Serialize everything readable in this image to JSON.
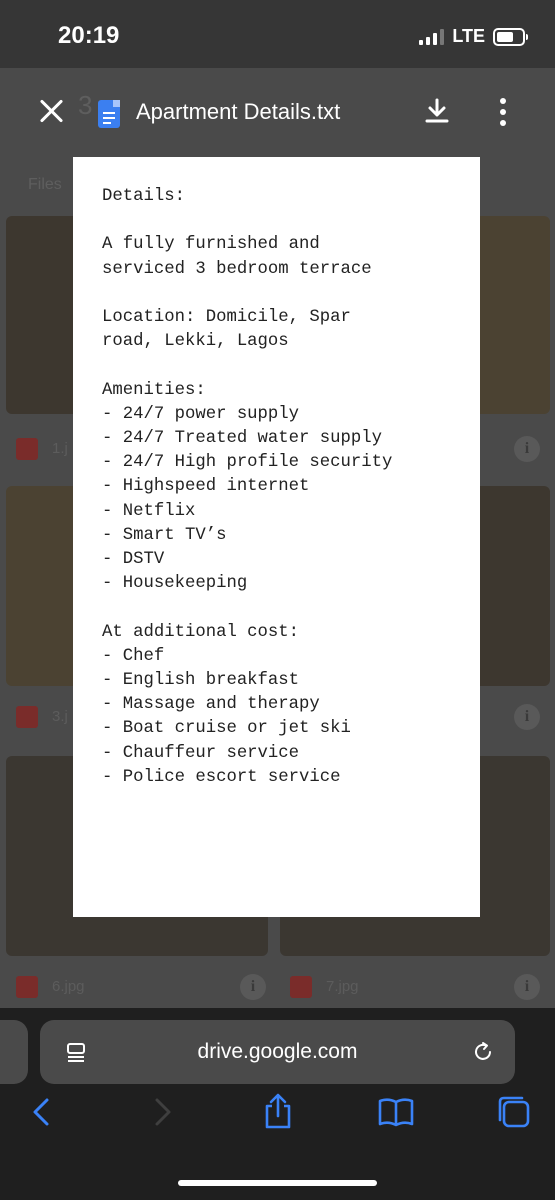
{
  "status_bar": {
    "time": "20:19",
    "network": "LTE"
  },
  "viewer": {
    "title": "Apartment Details.txt"
  },
  "background": {
    "folder_title": "3",
    "section_label": "Files",
    "files": [
      "1.j",
      "3.j",
      "6.jpg",
      "7.jpg"
    ]
  },
  "document": {
    "lines": [
      "Details:",
      "",
      "A fully furnished and",
      "serviced 3 bedroom terrace",
      "",
      "Location: Domicile, Spar",
      "road, Lekki, Lagos",
      "",
      "Amenities:",
      "- 24/7 power supply",
      "- 24/7 Treated water supply",
      "- 24/7 High profile security",
      "- Highspeed internet",
      "- Netflix",
      "- Smart TV’s",
      "- DSTV",
      "- Housekeeping",
      "",
      "At additional cost:",
      "- Chef",
      "- English breakfast",
      "- Massage and therapy",
      "- Boat cruise or jet ski",
      "- Chauffeur service",
      "- Police escort service"
    ]
  },
  "browser": {
    "url": "drive.google.com"
  },
  "colors": {
    "accent": "#3b7ff0",
    "toolbar_icon": "#3a82f7"
  }
}
